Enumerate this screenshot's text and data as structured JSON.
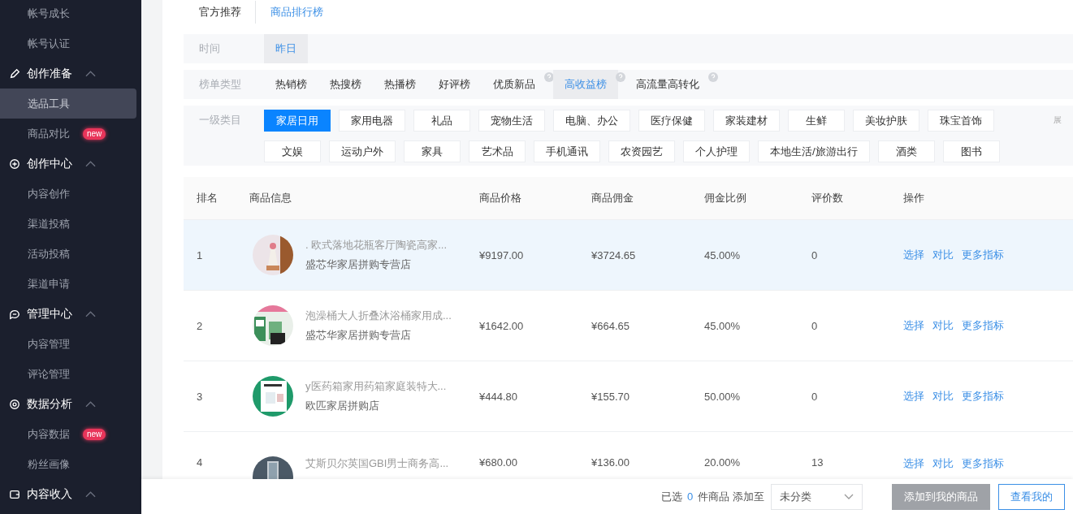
{
  "sidebar": {
    "sections": [
      {
        "items": [
          {
            "label": "帐号成长",
            "selected": false
          },
          {
            "label": "帐号认证",
            "selected": false
          }
        ]
      },
      {
        "label": "创作准备",
        "expanded": true,
        "items": [
          {
            "label": "选品工具",
            "selected": true
          },
          {
            "label": "商品对比",
            "selected": false,
            "badge": "new"
          }
        ]
      },
      {
        "label": "创作中心",
        "expanded": true,
        "items": [
          {
            "label": "内容创作",
            "selected": false
          },
          {
            "label": "渠道投稿",
            "selected": false
          },
          {
            "label": "活动投稿",
            "selected": false
          },
          {
            "label": "渠道申请",
            "selected": false
          }
        ]
      },
      {
        "label": "管理中心",
        "expanded": true,
        "items": [
          {
            "label": "内容管理",
            "selected": false
          },
          {
            "label": "评论管理",
            "selected": false
          }
        ]
      },
      {
        "label": "数据分析",
        "expanded": true,
        "items": [
          {
            "label": "内容数据",
            "selected": false,
            "badge": "new"
          },
          {
            "label": "粉丝画像",
            "selected": false
          }
        ]
      },
      {
        "label": "内容收入",
        "expanded": true
      }
    ]
  },
  "tabs": [
    {
      "label": "官方推荐",
      "selected": false
    },
    {
      "label": "商品排行榜",
      "selected": true
    }
  ],
  "filters": {
    "time": {
      "label": "时间",
      "options": [
        {
          "label": "昨日",
          "selected": true
        }
      ]
    },
    "list_type": {
      "label": "榜单类型",
      "options": [
        {
          "label": "热销榜",
          "selected": false,
          "help": false
        },
        {
          "label": "热搜榜",
          "selected": false,
          "help": false
        },
        {
          "label": "热播榜",
          "selected": false,
          "help": false
        },
        {
          "label": "好评榜",
          "selected": false,
          "help": false
        },
        {
          "label": "优质新品",
          "selected": false,
          "help": true
        },
        {
          "label": "高收益榜",
          "selected": true,
          "help": true
        },
        {
          "label": "高流量高转化",
          "selected": false,
          "help": true
        }
      ]
    },
    "category": {
      "label": "一级类目",
      "expand": "展",
      "options": [
        {
          "label": "家居日用",
          "selected": true
        },
        {
          "label": "家用电器",
          "selected": false
        },
        {
          "label": "礼品",
          "selected": false
        },
        {
          "label": "宠物生活",
          "selected": false
        },
        {
          "label": "电脑、办公",
          "selected": false
        },
        {
          "label": "医疗保健",
          "selected": false
        },
        {
          "label": "家装建材",
          "selected": false
        },
        {
          "label": "生鲜",
          "selected": false
        },
        {
          "label": "美妆护肤",
          "selected": false
        },
        {
          "label": "珠宝首饰",
          "selected": false
        },
        {
          "label": "文娱",
          "selected": false
        },
        {
          "label": "运动户外",
          "selected": false
        },
        {
          "label": "家具",
          "selected": false
        },
        {
          "label": "艺术品",
          "selected": false
        },
        {
          "label": "手机通讯",
          "selected": false
        },
        {
          "label": "农资园艺",
          "selected": false
        },
        {
          "label": "个人护理",
          "selected": false
        },
        {
          "label": "本地生活/旅游出行",
          "selected": false
        },
        {
          "label": "酒类",
          "selected": false
        },
        {
          "label": "图书",
          "selected": false
        }
      ]
    }
  },
  "table": {
    "columns": [
      "排名",
      "商品信息",
      "商品价格",
      "商品佣金",
      "佣金比例",
      "评价数",
      "操作"
    ],
    "rows": [
      {
        "rank": "1",
        "title": ". 欧式落地花瓶客厅陶瓷高家...",
        "shop": "盛芯华家居拼购专营店",
        "price": "¥9197.00",
        "commission": "¥3724.65",
        "rate": "45.00%",
        "reviews": "0",
        "actions": [
          "选择",
          "对比",
          "更多指标"
        ],
        "selected": true
      },
      {
        "rank": "2",
        "title": "泡澡桶大人折叠沐浴桶家用成...",
        "shop": "盛芯华家居拼购专营店",
        "price": "¥1642.00",
        "commission": "¥664.65",
        "rate": "45.00%",
        "reviews": "0",
        "actions": [
          "选择",
          "对比",
          "更多指标"
        ],
        "selected": false
      },
      {
        "rank": "3",
        "title": "y医药箱家用药箱家庭装特大...",
        "shop": "欧匹家居拼购店",
        "price": "¥444.80",
        "commission": "¥155.70",
        "rate": "50.00%",
        "reviews": "0",
        "actions": [
          "选择",
          "对比",
          "更多指标"
        ],
        "selected": false
      },
      {
        "rank": "4",
        "title": "艾斯贝尔英国GBI男士商务高...",
        "price": "¥680.00",
        "commission": "¥136.00",
        "rate": "20.00%",
        "reviews": "13",
        "actions": [
          "选择",
          "对比",
          "更多指标"
        ],
        "selected": false
      }
    ]
  },
  "footer": {
    "selected_prefix": "已选",
    "selected_count": "0",
    "selected_suffix": "件商品 添加至",
    "category_select": "未分类",
    "buttons": [
      {
        "label": "添加到我的商品",
        "disabled": true
      },
      {
        "label": "查看我的",
        "disabled": false
      }
    ]
  }
}
